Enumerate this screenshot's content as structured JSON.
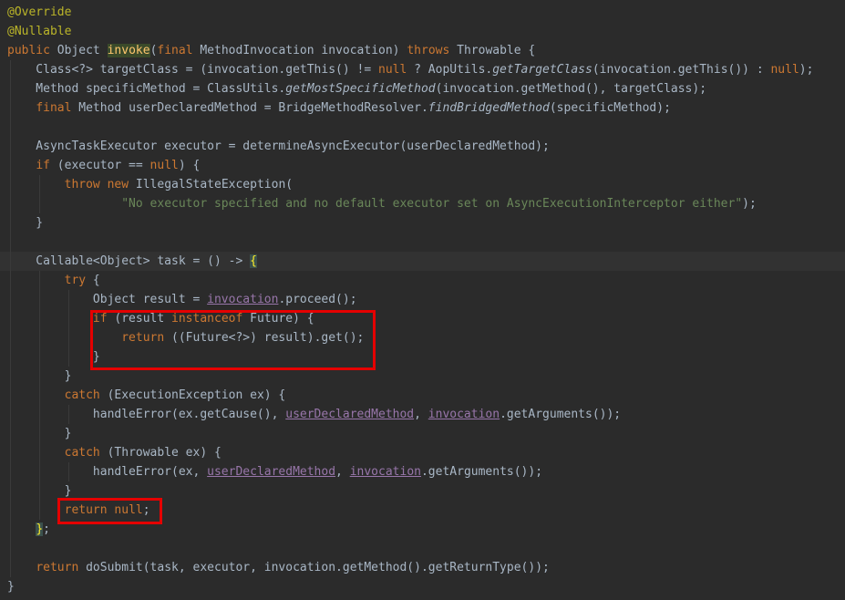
{
  "lines": [
    {
      "segs": [
        {
          "t": "@Override",
          "c": "ann"
        }
      ]
    },
    {
      "segs": [
        {
          "t": "@Nullable",
          "c": "ann"
        }
      ]
    },
    {
      "segs": [
        {
          "t": "public",
          "c": "kw"
        },
        {
          "t": " Object "
        },
        {
          "t": "invoke",
          "c": "hlfn"
        },
        {
          "t": "("
        },
        {
          "t": "final",
          "c": "kw"
        },
        {
          "t": " MethodInvocation invocation) "
        },
        {
          "t": "throws",
          "c": "kw"
        },
        {
          "t": " Throwable {"
        }
      ]
    },
    {
      "segs": [
        {
          "t": "    Class<?> targetClass = (invocation.getThis() != "
        },
        {
          "t": "null",
          "c": "kw"
        },
        {
          "t": " ? AopUtils."
        },
        {
          "t": "getTargetClass",
          "c": "it"
        },
        {
          "t": "(invocation.getThis()) : "
        },
        {
          "t": "null",
          "c": "kw"
        },
        {
          "t": ");"
        }
      ]
    },
    {
      "segs": [
        {
          "t": "    Method specificMethod = ClassUtils."
        },
        {
          "t": "getMostSpecificMethod",
          "c": "it"
        },
        {
          "t": "(invocation.getMethod(), targetClass);"
        }
      ]
    },
    {
      "segs": [
        {
          "t": "    "
        },
        {
          "t": "final",
          "c": "kw"
        },
        {
          "t": " Method userDeclaredMethod = BridgeMethodResolver."
        },
        {
          "t": "findBridgedMethod",
          "c": "it"
        },
        {
          "t": "(specificMethod);"
        }
      ]
    },
    {
      "segs": [
        {
          "t": ""
        }
      ]
    },
    {
      "segs": [
        {
          "t": "    AsyncTaskExecutor executor = determineAsyncExecutor(userDeclaredMethod);"
        }
      ]
    },
    {
      "segs": [
        {
          "t": "    "
        },
        {
          "t": "if",
          "c": "kw"
        },
        {
          "t": " (executor == "
        },
        {
          "t": "null",
          "c": "kw"
        },
        {
          "t": ") {"
        }
      ]
    },
    {
      "segs": [
        {
          "t": "        "
        },
        {
          "t": "throw new",
          "c": "kw"
        },
        {
          "t": " IllegalStateException("
        }
      ]
    },
    {
      "segs": [
        {
          "t": "                "
        },
        {
          "t": "\"No executor specified and no default executor set on AsyncExecutionInterceptor either\"",
          "c": "str"
        },
        {
          "t": ");"
        }
      ]
    },
    {
      "segs": [
        {
          "t": "    }"
        }
      ]
    },
    {
      "segs": [
        {
          "t": ""
        }
      ]
    },
    {
      "segs": [
        {
          "t": "    Callable<Object> task = () -> "
        },
        {
          "t": "{",
          "c": "brace-hl"
        }
      ]
    },
    {
      "segs": [
        {
          "t": "        "
        },
        {
          "t": "try",
          "c": "kw"
        },
        {
          "t": " {"
        }
      ]
    },
    {
      "segs": [
        {
          "t": "            Object result = "
        },
        {
          "t": "invocation",
          "c": "ul"
        },
        {
          "t": ".proceed();"
        }
      ]
    },
    {
      "segs": [
        {
          "t": "            "
        },
        {
          "t": "if",
          "c": "kw"
        },
        {
          "t": " (result "
        },
        {
          "t": "instanceof",
          "c": "kw"
        },
        {
          "t": " Future) {"
        }
      ]
    },
    {
      "segs": [
        {
          "t": "                "
        },
        {
          "t": "return",
          "c": "kw"
        },
        {
          "t": " ((Future<?>) result).get();"
        }
      ]
    },
    {
      "segs": [
        {
          "t": "            }"
        }
      ]
    },
    {
      "segs": [
        {
          "t": "        }"
        }
      ]
    },
    {
      "segs": [
        {
          "t": "        "
        },
        {
          "t": "catch",
          "c": "kw"
        },
        {
          "t": " (ExecutionException ex) {"
        }
      ]
    },
    {
      "segs": [
        {
          "t": "            handleError(ex.getCause(), "
        },
        {
          "t": "userDeclaredMethod",
          "c": "ul"
        },
        {
          "t": ", "
        },
        {
          "t": "invocation",
          "c": "ul"
        },
        {
          "t": ".getArguments());"
        }
      ]
    },
    {
      "segs": [
        {
          "t": "        }"
        }
      ]
    },
    {
      "segs": [
        {
          "t": "        "
        },
        {
          "t": "catch",
          "c": "kw"
        },
        {
          "t": " (Throwable ex) {"
        }
      ]
    },
    {
      "segs": [
        {
          "t": "            handleError(ex, "
        },
        {
          "t": "userDeclaredMethod",
          "c": "ul"
        },
        {
          "t": ", "
        },
        {
          "t": "invocation",
          "c": "ul"
        },
        {
          "t": ".getArguments());"
        }
      ]
    },
    {
      "segs": [
        {
          "t": "        }"
        }
      ]
    },
    {
      "segs": [
        {
          "t": "        "
        },
        {
          "t": "return null",
          "c": "kw"
        },
        {
          "t": ";"
        }
      ]
    },
    {
      "segs": [
        {
          "t": "    "
        },
        {
          "t": "}",
          "c": "brace-hl"
        },
        {
          "t": ";"
        }
      ]
    },
    {
      "segs": [
        {
          "t": ""
        }
      ]
    },
    {
      "segs": [
        {
          "t": "    "
        },
        {
          "t": "return",
          "c": "kw"
        },
        {
          "t": " doSubmit(task, executor, invocation.getMethod().getReturnType());"
        }
      ]
    },
    {
      "segs": [
        {
          "t": "}"
        }
      ]
    }
  ],
  "colors": {
    "background": "#2b2b2b",
    "keyword": "#cc7832",
    "annotation": "#bbb529",
    "string": "#6a8759",
    "field": "#9876aa",
    "highlight_box": "#e50000"
  }
}
